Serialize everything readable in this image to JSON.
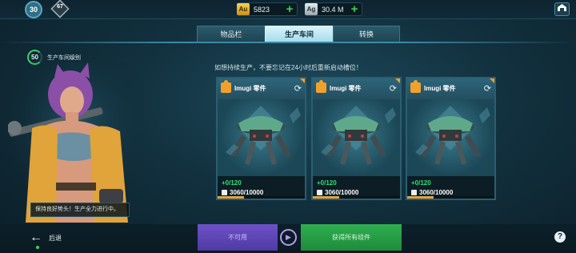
{
  "topbar": {
    "player_level": "30",
    "rank_badge": "67",
    "gold": {
      "icon_label": "Au",
      "value": "5823"
    },
    "silver": {
      "icon_label": "Ag",
      "value": "30.4 M"
    },
    "hangar_icon": "hangar-icon"
  },
  "tabs": [
    {
      "label": "物品栏",
      "active": false
    },
    {
      "label": "生产车间",
      "active": true
    },
    {
      "label": "转换",
      "active": false
    }
  ],
  "workshop": {
    "level": "50",
    "level_label": "生产车间级别",
    "speech": "保持良好势头！生产全力进行中。"
  },
  "notice": "如想持续生产，不要忘记在24小时后重新启动槽位！",
  "cards": [
    {
      "title": "Imugi 零件",
      "count": "+0/120",
      "progress": "3060/10000",
      "progress_fraction": 0.306
    },
    {
      "title": "Imugi 零件",
      "count": "+0/120",
      "progress": "3060/10000",
      "progress_fraction": 0.306
    },
    {
      "title": "Imugi 零件",
      "count": "+0/120",
      "progress": "3060/10000",
      "progress_fraction": 0.306
    }
  ],
  "bottom": {
    "back_label": "后退",
    "unavailable_label": "不可用",
    "collect_label": "获得所有组件",
    "help_label": "?"
  },
  "colors": {
    "accent_gold": "#f2a02c",
    "count_green": "#2fe17a",
    "purple_button": "#6d52c7",
    "green_button": "#2fae4f"
  }
}
